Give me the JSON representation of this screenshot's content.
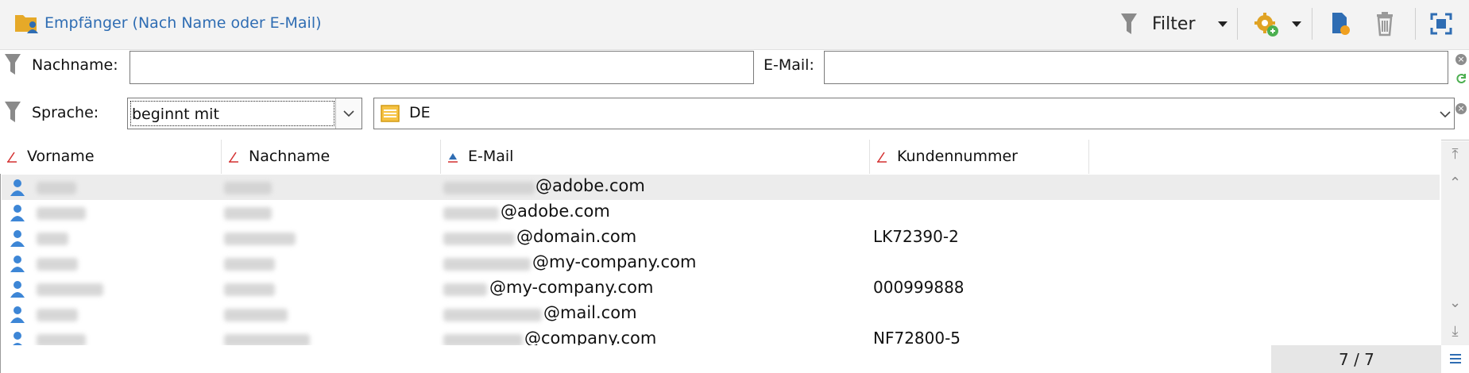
{
  "toolbar": {
    "title": "Empfänger (Nach Name oder E-Mail)",
    "filter_label": "Filter",
    "icons": [
      "folder-person-icon",
      "funnel-icon",
      "dropdown-arrow-icon",
      "gear-add-icon",
      "dropdown-arrow-icon",
      "new-record-icon",
      "trash-icon",
      "fullscreen-icon"
    ]
  },
  "filters": {
    "nachname_label": "Nachname:",
    "nachname_value": "",
    "email_label": "E-Mail:",
    "email_value": "",
    "sprache_label": "Sprache:",
    "operator_value": "beginnt mit",
    "sprache_value": "DE"
  },
  "grid": {
    "columns": [
      "Vorname",
      "Nachname",
      "E-Mail",
      "Kundennummer"
    ],
    "sorted_column": "E-Mail",
    "rows": [
      {
        "email": "@adobe.com",
        "customer_no": "",
        "selected": true
      },
      {
        "email": "@adobe.com",
        "customer_no": "",
        "selected": false
      },
      {
        "email": "@domain.com",
        "customer_no": "LK72390-2",
        "selected": false
      },
      {
        "email": "@my-company.com",
        "customer_no": "",
        "selected": false
      },
      {
        "email": "@my-company.com",
        "customer_no": "000999888",
        "selected": false
      },
      {
        "email": "@mail.com",
        "customer_no": "",
        "selected": false
      },
      {
        "email": "@company.com",
        "customer_no": "NF72800-5",
        "selected": false
      }
    ]
  },
  "status": {
    "count": "7 / 7"
  },
  "colors": {
    "accent": "#2f6db3",
    "person_icon": "#3d86d6",
    "sort_marker": "#d32f2f"
  }
}
